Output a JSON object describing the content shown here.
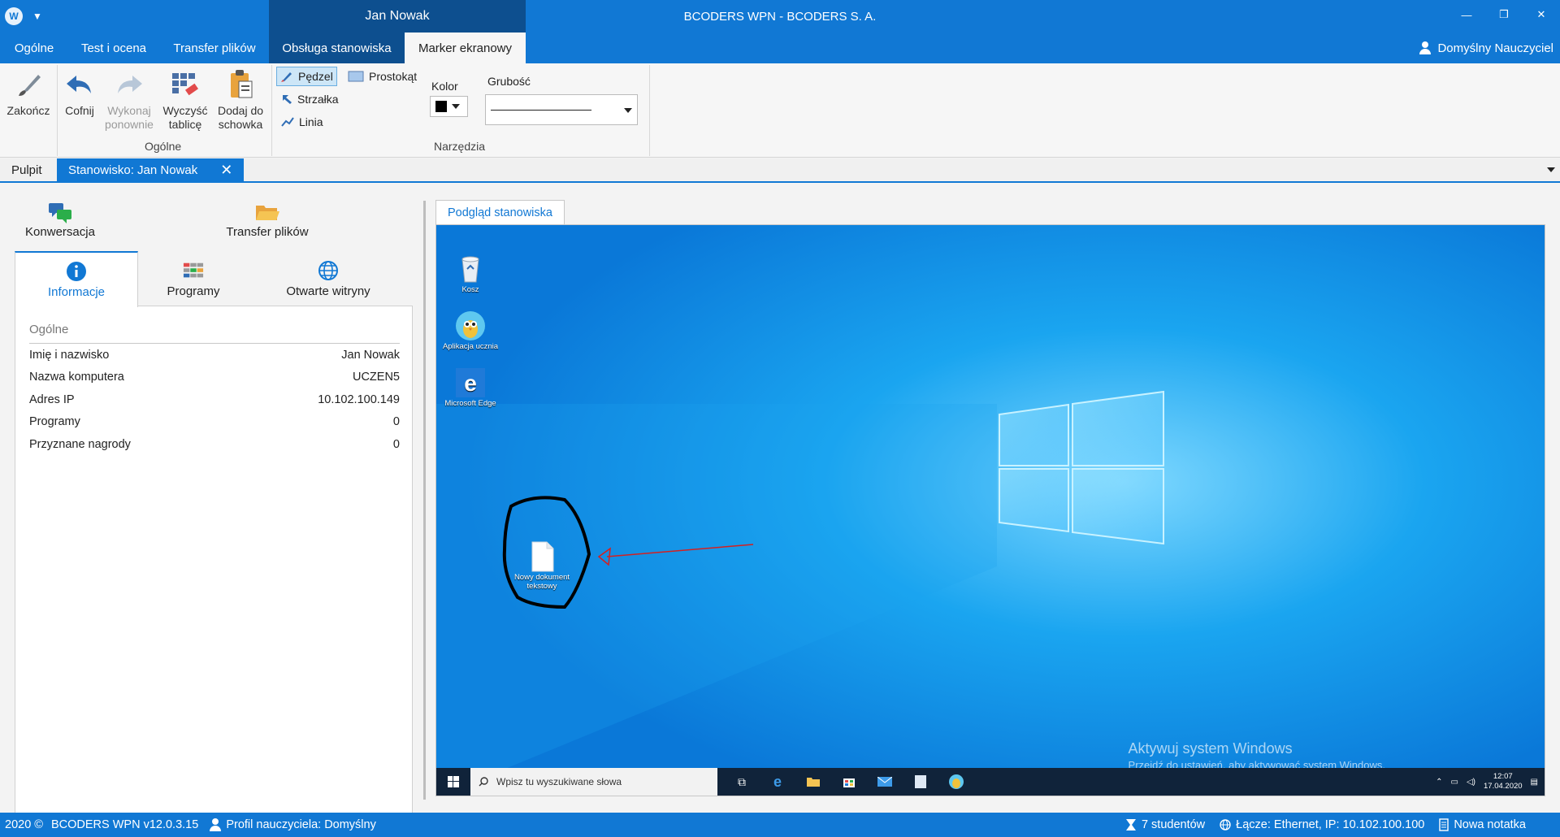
{
  "titlebar": {
    "app_title": "BCODERS WPN - BCODERS S. A.",
    "context_tab_header": "Jan Nowak",
    "minimize": "—",
    "restore": "❐",
    "close": "✕"
  },
  "ribbon_tabs": [
    {
      "label": "Ogólne"
    },
    {
      "label": "Test i ocena"
    },
    {
      "label": "Transfer plików"
    },
    {
      "label": "Obsługa stanowiska"
    },
    {
      "label": "Marker ekranowy"
    }
  ],
  "user": {
    "label": "Domyślny Nauczyciel"
  },
  "ribbon": {
    "general": {
      "finish": "Zakończ",
      "undo": "Cofnij",
      "redo_1": "Wykonaj",
      "redo_2": "ponownie",
      "clear_1": "Wyczyść",
      "clear_2": "tablicę",
      "clipboard_1": "Dodaj do",
      "clipboard_2": "schowka",
      "group_label": "Ogólne"
    },
    "tools": {
      "brush": "Pędzel",
      "rectangle": "Prostokąt",
      "arrow": "Strzałka",
      "line": "Linia",
      "color_label": "Kolor",
      "color_value": "#000000",
      "thickness_label": "Grubość",
      "group_label": "Narzędzia"
    }
  },
  "doc_tabs": {
    "desktop": "Pulpit",
    "station": "Stanowisko: Jan Nowak",
    "close": "✕"
  },
  "left_panel": {
    "top_tabs": {
      "chat": "Konwersacja",
      "transfer": "Transfer plików"
    },
    "sub_tabs": {
      "info": "Informacje",
      "programs": "Programy",
      "sites": "Otwarte witryny"
    },
    "section_title": "Ogólne",
    "rows": [
      {
        "label": "Imię i nazwisko",
        "value": "Jan Nowak"
      },
      {
        "label": "Nazwa komputera",
        "value": "UCZEN5"
      },
      {
        "label": "Adres IP",
        "value": "10.102.100.149"
      },
      {
        "label": "Programy",
        "value": "0"
      },
      {
        "label": "Przyznane nagrody",
        "value": "0"
      }
    ]
  },
  "preview": {
    "tab_label": "Podgląd stanowiska",
    "desktop_icons": [
      {
        "label": "Kosz",
        "icon": "recycle-bin-icon"
      },
      {
        "label": "Aplikacja ucznia",
        "icon": "owl-app-icon"
      },
      {
        "label": "Microsoft Edge",
        "icon": "edge-icon"
      },
      {
        "label": "Nowy dokument tekstowy",
        "icon": "text-document-icon"
      }
    ],
    "activate_line1": "Aktywuj system Windows",
    "activate_line2": "Przejdź do ustawień, aby aktywować system Windows.",
    "search_placeholder": "Wpisz tu wyszukiwane słowa",
    "clock_time": "12:07",
    "clock_date": "17.04.2020"
  },
  "statusbar": {
    "copyright": "2020 ©",
    "version": "BCODERS WPN v12.0.3.15",
    "profile": "Profil nauczyciela: Domyślny",
    "students": "7 studentów",
    "connection": "Łącze: Ethernet, IP: 10.102.100.100",
    "note": "Nowa notatka"
  },
  "colors": {
    "accent": "#1178d4",
    "context_tab": "#0d4f8f",
    "desktop_blue": "#1aa5f0"
  }
}
